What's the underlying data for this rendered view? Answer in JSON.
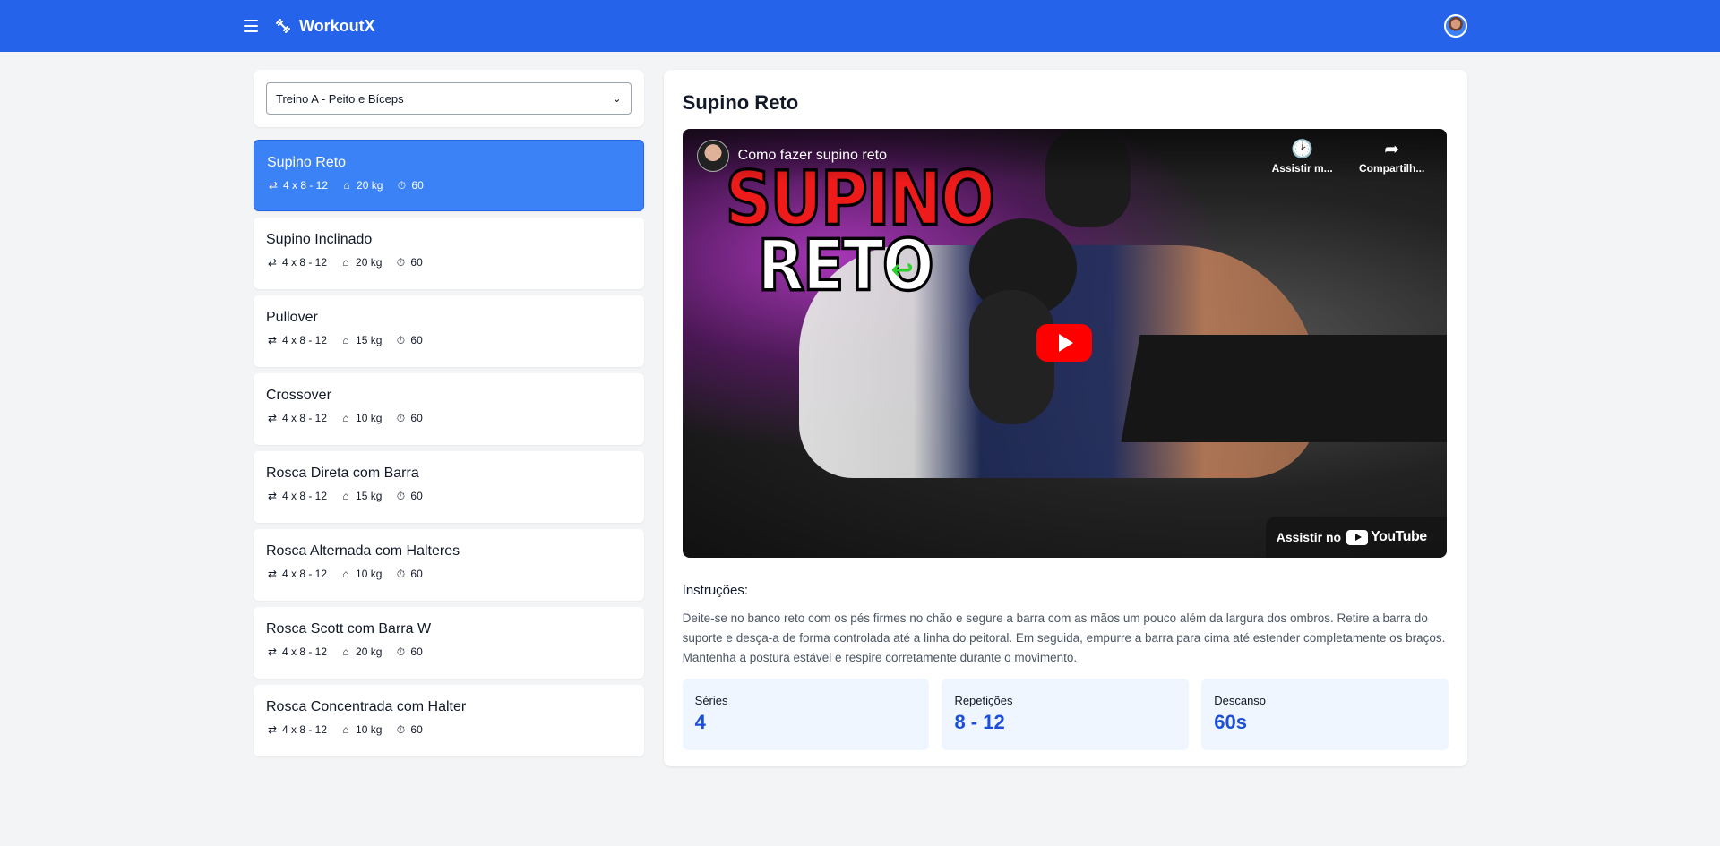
{
  "app": {
    "brand": "WorkoutX"
  },
  "workout_select": {
    "value": "Treino A - Peito e Bíceps"
  },
  "exercises": [
    {
      "name": "Supino Reto",
      "sets": "4 x 8 - 12",
      "weight": "20 kg",
      "rest": "60",
      "active": true
    },
    {
      "name": "Supino Inclinado",
      "sets": "4 x 8 - 12",
      "weight": "20 kg",
      "rest": "60"
    },
    {
      "name": "Pullover",
      "sets": "4 x 8 - 12",
      "weight": "15 kg",
      "rest": "60"
    },
    {
      "name": "Crossover",
      "sets": "4 x 8 - 12",
      "weight": "10 kg",
      "rest": "60"
    },
    {
      "name": "Rosca Direta com Barra",
      "sets": "4 x 8 - 12",
      "weight": "15 kg",
      "rest": "60"
    },
    {
      "name": "Rosca Alternada com Halteres",
      "sets": "4 x 8 - 12",
      "weight": "10 kg",
      "rest": "60"
    },
    {
      "name": "Rosca Scott com Barra W",
      "sets": "4 x 8 - 12",
      "weight": "20 kg",
      "rest": "60"
    },
    {
      "name": "Rosca Concentrada com Halter",
      "sets": "4 x 8 - 12",
      "weight": "10 kg",
      "rest": "60"
    }
  ],
  "detail": {
    "title": "Supino Reto",
    "video": {
      "title": "Como fazer supino reto",
      "watch_later": "Assistir m...",
      "share": "Compartilh...",
      "thumb_line1": "SUPINO",
      "thumb_line2": "RETO",
      "watch_on": "Assistir no",
      "youtube": "YouTube"
    },
    "instructions_title": "Instruções:",
    "instructions": "Deite-se no banco reto com os pés firmes no chão e segure a barra com as mãos um pouco além da largura dos ombros. Retire a barra do suporte e desça-a de forma controlada até a linha do peitoral. Em seguida, empurre a barra para cima até estender completamente os braços. Mantenha a postura estável e respire corretamente durante o movimento.",
    "stats": {
      "series_label": "Séries",
      "series_value": "4",
      "reps_label": "Repetições",
      "reps_value": "8 - 12",
      "rest_label": "Descanso",
      "rest_value": "60s"
    }
  },
  "icons": {
    "menu": "menu-icon",
    "logo": "dumbbell-icon",
    "repeat": "repeat-icon",
    "weight": "kettlebell-icon",
    "timer": "stopwatch-icon",
    "clock": "clock-icon",
    "share": "share-icon"
  },
  "colors": {
    "primary": "#2563eb",
    "active_item": "#3b82f6",
    "stat_bg": "#eff6ff",
    "stat_value": "#1d4ed8"
  }
}
